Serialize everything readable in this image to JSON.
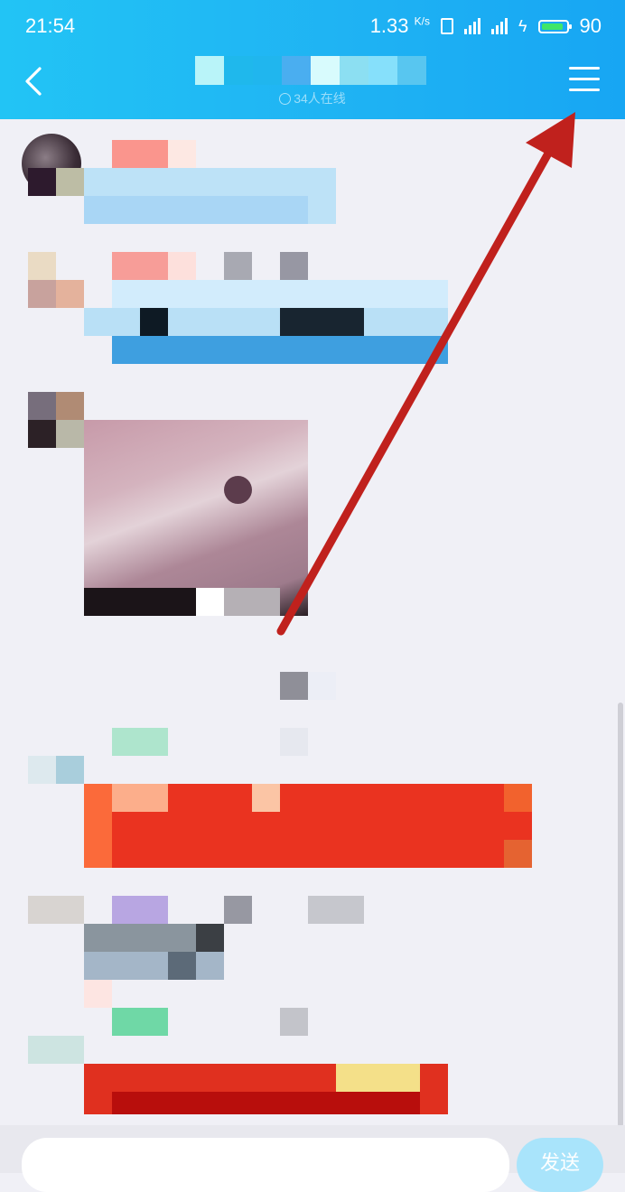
{
  "status_bar": {
    "time": "21:54",
    "speed": "1.33",
    "speed_unit": "K/s",
    "battery": "90",
    "battery_level": 0.9
  },
  "header": {
    "online_text": "34人在线",
    "back_icon": "chevron-left-icon",
    "menu_icon": "hamburger-menu-icon"
  },
  "input_bar": {
    "placeholder": "",
    "send_label": "发送"
  },
  "colors": {
    "header_start": "#22c4f5",
    "header_end": "#17a6f3",
    "chat_background": "#f0f0f6",
    "annotation_arrow": "#c0211d",
    "send_button": "#a9e4fb"
  }
}
